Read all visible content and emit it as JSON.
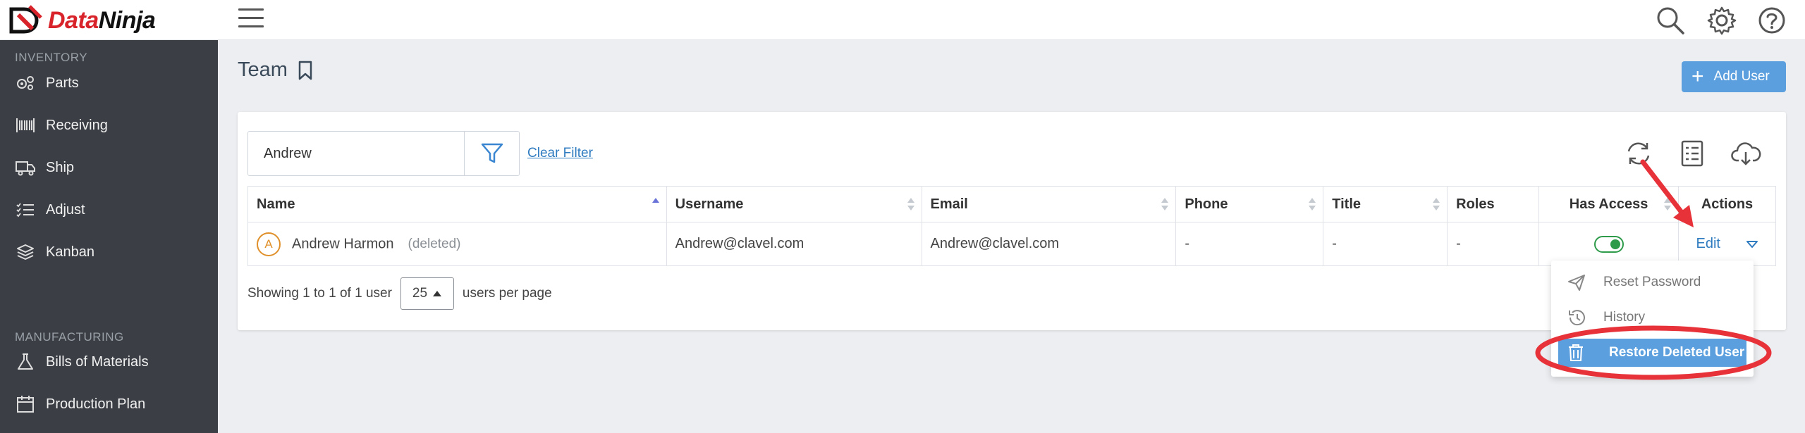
{
  "brand": {
    "name_data": "Data",
    "name_ninja": "Ninja"
  },
  "topbar": {
    "icons": [
      "menu-icon",
      "search-icon",
      "gear-icon",
      "help-icon"
    ]
  },
  "sidebar": {
    "sections": [
      {
        "label": "INVENTORY",
        "items": [
          {
            "label": "Parts",
            "icon": "gears-icon"
          },
          {
            "label": "Receiving",
            "icon": "barcode-icon"
          },
          {
            "label": "Ship",
            "icon": "truck-icon"
          },
          {
            "label": "Adjust",
            "icon": "list-check-icon"
          },
          {
            "label": "Kanban",
            "icon": "layers-icon"
          }
        ]
      },
      {
        "label": "MANUFACTURING",
        "items": [
          {
            "label": "Bills of Materials",
            "icon": "flask-icon"
          },
          {
            "label": "Production Plan",
            "icon": "calendar-icon"
          }
        ]
      }
    ]
  },
  "page": {
    "title": "Team",
    "add_user_label": "Add User"
  },
  "filter": {
    "value": "Andrew",
    "clear_label": "Clear Filter"
  },
  "table": {
    "columns": [
      "Name",
      "Username",
      "Email",
      "Phone",
      "Title",
      "Roles",
      "Has Access",
      "Actions"
    ],
    "rows": [
      {
        "avatar": "A",
        "name": "Andrew Harmon",
        "status": "(deleted)",
        "username": "Andrew@clavel.com",
        "email": "Andrew@clavel.com",
        "phone": "-",
        "title": "-",
        "roles": "-",
        "has_access": true,
        "action": "Edit"
      }
    ]
  },
  "pager": {
    "showing": "Showing 1 to 1 of 1 user",
    "per_page": "25",
    "suffix": "users per page"
  },
  "menu": {
    "items": [
      "Reset Password",
      "History",
      "Restore Deleted User"
    ],
    "highlighted": "Restore Deleted User"
  },
  "colors": {
    "accent": "#5b9fde",
    "sidebar": "#3b3f45",
    "annotation": "#e8323a",
    "toggle_on": "#2e9b4a",
    "link": "#2f7bc0"
  }
}
